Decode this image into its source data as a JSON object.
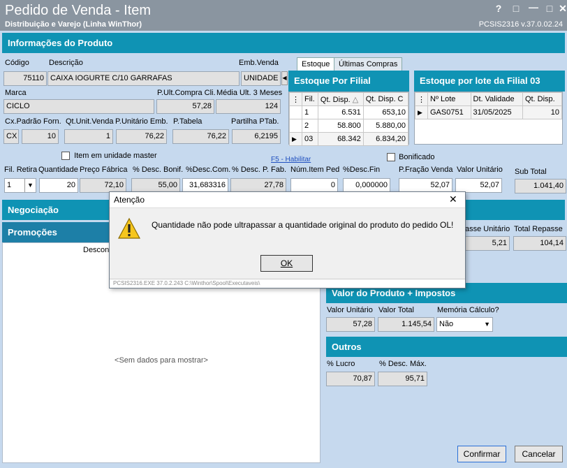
{
  "window": {
    "title": "Pedido de Venda - Item",
    "subtitle": "Distribuição e Varejo (Linha WinThor)",
    "version": "PCSIS2316  v.37.0.02.24",
    "help_icon": "?",
    "min_icon": "—",
    "restore_icon": "□",
    "close_icon": "✕"
  },
  "info": {
    "header": "Informações do Produto",
    "codigo_label": "Código",
    "codigo": "75110",
    "descricao_label": "Descrição",
    "descricao": "CAIXA IOGURTE C/10 GARRAFAS",
    "emb_label": "Emb.Venda",
    "emb": "UNIDADE",
    "marca_label": "Marca",
    "marca": "CICLO",
    "pult_label": "P.Ult.Compra Cli.",
    "pult": "57,28",
    "media_label": "Média Ult. 3 Meses",
    "media": "124",
    "cx_label": "Cx.Padrão Forn.",
    "cx_unit": "CX",
    "cx_val": "10",
    "qtunit_label": "Qt.Unit.Venda",
    "qtunit": "1",
    "punit_label": "P.Unitário Emb.",
    "punit": "76,22",
    "ptab_label": "P.Tabela",
    "ptab": "76,22",
    "partilha_label": "Partilha PTab.",
    "partilha": "6,2195",
    "master_label": "Item em unidade master",
    "f5_label": "F5 - Habilitar",
    "bonificado_label": "Bonificado"
  },
  "tabs": [
    "Estoque",
    "Últimas Compras"
  ],
  "estoque_filial": {
    "header": "Estoque Por Filial",
    "columns": [
      "Fil.",
      "Qt. Disp.",
      "Qt. Disp. C"
    ],
    "rows": [
      {
        "fil": "1",
        "qt": "6.531",
        "qtc": "653,10"
      },
      {
        "fil": "2",
        "qt": "58.800",
        "qtc": "5.880,00"
      },
      {
        "fil": "03",
        "qt": "68.342",
        "qtc": "6.834,20"
      }
    ]
  },
  "estoque_lote": {
    "header": "Estoque por lote da Filial 03",
    "columns": [
      "Nº Lote",
      "Dt. Validade",
      "Qt. Disp."
    ],
    "rows": [
      {
        "lote": "GAS0751",
        "validade": "31/05/2025",
        "qt": "10"
      }
    ]
  },
  "row2": {
    "fil_label": "Fil. Retira",
    "fil": "1",
    "qtd_label": "Quantidade",
    "qtd": "20",
    "pfab_label": "Preço Fábrica",
    "pfab": "72,10",
    "descbonif_label": "% Desc. Bonif.",
    "descbonif": "55,00",
    "desccom_label": "%Desc.Com.",
    "desccom": "31,683316",
    "descpfab_label": "% Desc. P. Fab.",
    "descpfab": "27,78",
    "numitem_label": "Núm.Item Ped",
    "numitem": "0",
    "descfin_label": "%Desc.Fin",
    "descfin": "0,000000",
    "pfracao_label": "P.Fração Venda",
    "pfracao": "52,07",
    "vunit_label": "Valor Unitário",
    "vunit": "52,07",
    "subtotal_label": "Sub Total",
    "subtotal": "1.041,40"
  },
  "negociacao": {
    "header": "Negociação"
  },
  "promocoes": {
    "header": "Promoções",
    "col": "Descont",
    "empty": "<Sem dados para mostrar>"
  },
  "repasse": {
    "unit_label": "asse Unitário",
    "unit": "5,21",
    "total_label": "Total Repasse",
    "total": "104,14"
  },
  "valor_produto": {
    "header": "Valor do Produto + Impostos",
    "vunit_label": "Valor Unitário",
    "vunit": "57,28",
    "vtotal_label": "Valor Total",
    "vtotal": "1.145,54",
    "memoria_label": "Memória Cálculo?",
    "memoria": "Não"
  },
  "outros": {
    "header": "Outros",
    "lucro_label": "% Lucro",
    "lucro": "70,87",
    "descmax_label": "% Desc. Máx.",
    "descmax": "95,71"
  },
  "buttons": {
    "confirmar": "Confirmar",
    "cancelar": "Cancelar"
  },
  "dialog": {
    "title": "Atenção",
    "message": "Quantidade não pode ultrapassar a quantidade original do produto do pedido OL!",
    "ok": "OK",
    "footer": "PCSIS2316.EXE 37.0.2.243 C:\\Winthor\\Spool\\Executaveis\\"
  }
}
